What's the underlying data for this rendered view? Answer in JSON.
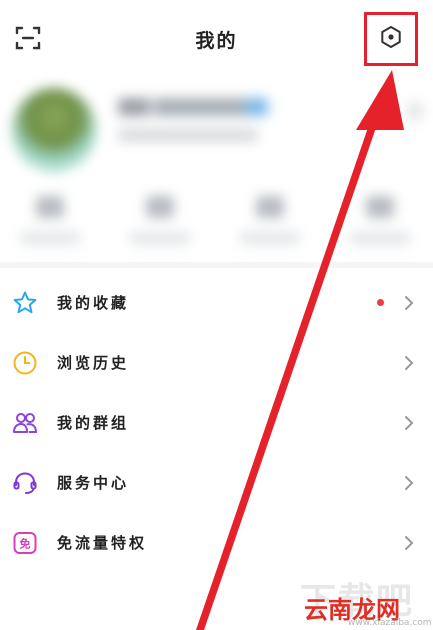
{
  "header": {
    "title": "我的",
    "scan_icon": "scan-icon",
    "settings_icon": "hexagon-settings-icon"
  },
  "menu": {
    "items": [
      {
        "label": "我的收藏",
        "icon": "star-icon",
        "icon_color": "#2aa7e8",
        "badge_dot": true
      },
      {
        "label": "浏览历史",
        "icon": "clock-icon",
        "icon_color": "#f2b51e",
        "badge_dot": false
      },
      {
        "label": "我的群组",
        "icon": "group-icon",
        "icon_color": "#8a46d8",
        "badge_dot": false
      },
      {
        "label": "服务中心",
        "icon": "headset-icon",
        "icon_color": "#7c3ad6",
        "badge_dot": false
      },
      {
        "label": "免流量特权",
        "icon": "free-data-icon",
        "icon_color": "#d63fb8",
        "badge_dot": false,
        "icon_text": "免"
      }
    ]
  },
  "annotation": {
    "highlight_color": "#e5212a"
  },
  "watermark": {
    "logo_text": "下载吧",
    "brand_text": "云南龙网",
    "url": "www.xiazaiba.com"
  }
}
